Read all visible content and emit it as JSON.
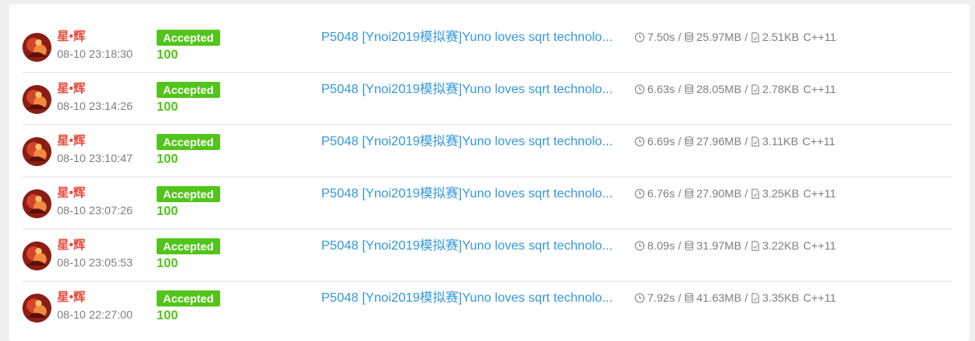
{
  "records": [
    {
      "user": "星•辉",
      "time": "08-10 23:18:30",
      "status": "Accepted",
      "score": "100",
      "problem": "P5048 [Ynoi2019模拟赛]Yuno loves sqrt technolo...",
      "runtime": "7.50s",
      "memory": "25.97MB",
      "code_size": "2.51KB",
      "language": "C++11"
    },
    {
      "user": "星•辉",
      "time": "08-10 23:14:26",
      "status": "Accepted",
      "score": "100",
      "problem": "P5048 [Ynoi2019模拟赛]Yuno loves sqrt technolo...",
      "runtime": "6.63s",
      "memory": "28.05MB",
      "code_size": "2.78KB",
      "language": "C++11"
    },
    {
      "user": "星•辉",
      "time": "08-10 23:10:47",
      "status": "Accepted",
      "score": "100",
      "problem": "P5048 [Ynoi2019模拟赛]Yuno loves sqrt technolo...",
      "runtime": "6.69s",
      "memory": "27.96MB",
      "code_size": "3.11KB",
      "language": "C++11"
    },
    {
      "user": "星•辉",
      "time": "08-10 23:07:26",
      "status": "Accepted",
      "score": "100",
      "problem": "P5048 [Ynoi2019模拟赛]Yuno loves sqrt technolo...",
      "runtime": "6.76s",
      "memory": "27.90MB",
      "code_size": "3.25KB",
      "language": "C++11"
    },
    {
      "user": "星•辉",
      "time": "08-10 23:05:53",
      "status": "Accepted",
      "score": "100",
      "problem": "P5048 [Ynoi2019模拟赛]Yuno loves sqrt technolo...",
      "runtime": "8.09s",
      "memory": "31.97MB",
      "code_size": "3.22KB",
      "language": "C++11"
    },
    {
      "user": "星•辉",
      "time": "08-10 22:27:00",
      "status": "Accepted",
      "score": "100",
      "problem": "P5048 [Ynoi2019模拟赛]Yuno loves sqrt technolo...",
      "runtime": "7.92s",
      "memory": "41.63MB",
      "code_size": "3.35KB",
      "language": "C++11"
    }
  ],
  "separator": "/",
  "icons": {
    "runtime": "clock-icon",
    "memory": "database-icon",
    "code_size": "file-icon"
  },
  "colors": {
    "accepted": "#52c41a",
    "user_name": "#e74c3c",
    "link": "#3498db",
    "meta": "#7f7f7f"
  }
}
